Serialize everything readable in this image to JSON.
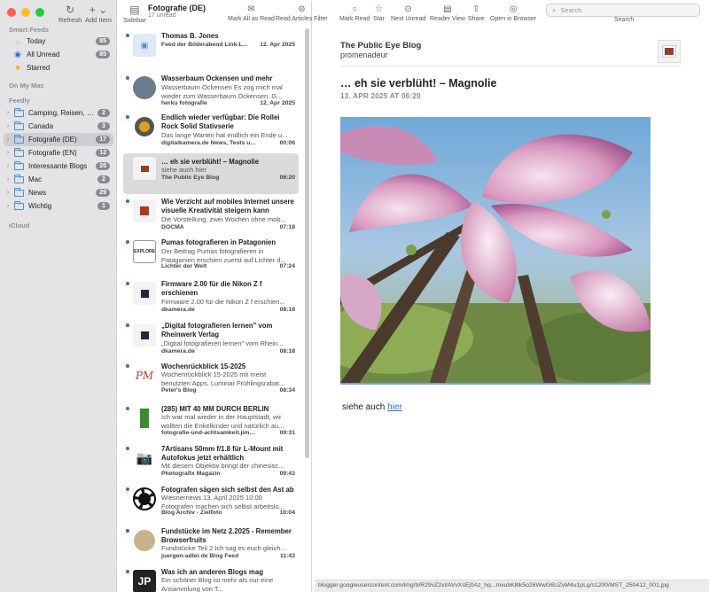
{
  "sidebar": {
    "refresh_label": "Refresh",
    "add_item_label": "Add Item",
    "smart_feeds_header": "Smart Feeds",
    "smart_feeds": [
      {
        "label": "Today",
        "count": "85"
      },
      {
        "label": "All Unread",
        "count": "85"
      },
      {
        "label": "Starred",
        "count": ""
      }
    ],
    "on_my_mac_header": "On My Mac",
    "feedly_header": "Feedly",
    "folders": [
      {
        "label": "Camping, Reisen, Ge...",
        "count": "2"
      },
      {
        "label": "Canada",
        "count": "3"
      },
      {
        "label": "Fotografie (DE)",
        "count": "17"
      },
      {
        "label": "Fotografie (EN)",
        "count": "12"
      },
      {
        "label": "Interessante Blogs",
        "count": "20"
      },
      {
        "label": "Mac",
        "count": "2"
      },
      {
        "label": "News",
        "count": "29"
      },
      {
        "label": "Wichtig",
        "count": "1"
      }
    ],
    "icloud_header": "iCloud"
  },
  "list": {
    "sidebar_btn_label": "Sidebar",
    "title": "Fotografie (DE)",
    "subtitle": "17 unread",
    "articles": [
      {
        "title": "Thomas B. Jones",
        "summary": "",
        "source": "Feed der Bilderabend Link-L...",
        "date": "12. Apr 2025"
      },
      {
        "title": "Wasserbaum Ockensen und mehr",
        "summary": "Wasserbaum Ockensen Es zog mich mal wieder zum Wasserbaum Ockensen. G...",
        "source": "herku fotografie",
        "date": "12. Apr 2025"
      },
      {
        "title": "Endlich wieder verfügbar: Die Rollei Rock Solid Stativserie",
        "summary": "Das lange Warten hat endlich ein Ende u...",
        "source": "digitalkamera.de News, Tests und...",
        "date": "00:06"
      },
      {
        "title": "… eh sie verblüht! – Magnolie",
        "summary": "siehe auch hier",
        "source": "The Public Eye Blog",
        "date": "06:20"
      },
      {
        "title": "Wie Verzicht auf mobiles Internet unsere visuelle Kreativität steigern kann",
        "summary": "Die Vorstellung, zwei Wochen ohne mob...",
        "source": "DOCMA",
        "date": "07:18"
      },
      {
        "title": "Pumas fotografieren in Patagonien",
        "summary": "Der Beitrag Pumas fotografieren in Patagonien erschien zuerst auf Lichter d...",
        "source": "Lichter der Welt",
        "date": "07:24"
      },
      {
        "title": "Firmware 2.00 für die Nikon Z f erschienen",
        "summary": "Firmware 2.00 für die Nikon Z f erschien...",
        "source": "dkamera.de",
        "date": "08:18"
      },
      {
        "title": "„Digital fotografieren lernen\" vom Rheinwerk Verlag",
        "summary": "„Digital fotografieren lernen\" vom Rhein...",
        "source": "dkamera.de",
        "date": "08:18"
      },
      {
        "title": "Wochenrückblick 15-2025",
        "summary": "Wochenrückblick 15-2025 mit meist benutzten Apps, Luminar Frühlingsrabat...",
        "source": "Peter's Blog",
        "date": "08:34"
      },
      {
        "title": "(285) MIT 40 MM DURCH BERLIN",
        "summary": "Ich war mal wieder in der Hauptstadt, wir wollten die Enkelkinder und natürlich au...",
        "source": "fotografie-und-achtsamkeit.jimdof...",
        "date": "09:31"
      },
      {
        "title": "7Artisans 50mm f/1.8 für L-Mount mit Autofokus jetzt erhältlich",
        "summary": "Mit diesem Objektiv bringt der chinesisc...",
        "source": "Photografix Magazin",
        "date": "09:43"
      },
      {
        "title": "Fotografen sägen sich selbst den Ast ab",
        "summary": "Wiesnernews 13. April 2025 10:00 Fotografen machen sich selbst arbeitslo...",
        "source": "Blog Archiv - Zielfoto",
        "date": "10:04"
      },
      {
        "title": "Fundstücke im Netz 2.2025 - Remember Browserfruits",
        "summary": "Fundstücke Teil 2 Ich sag es euch gleich...",
        "source": "juergen-adler.de Blog Feed",
        "date": "11:43"
      },
      {
        "title": "Was ich an anderen Blogs mag",
        "summary": "Ein schöner Blog ist mehr als nur eine Ansammlung von T...",
        "source": "",
        "date": ""
      }
    ]
  },
  "toolbar": {
    "mark_all_read": "Mark All as Read",
    "read_articles_filter": "Read Articles Filter",
    "mark_read": "Mark Read",
    "star": "Star",
    "next_unread": "Next Unread",
    "reader_view": "Reader View",
    "share": "Share",
    "open_in_browser": "Open in Browser",
    "search_placeholder": "Search",
    "search_label": "Search"
  },
  "content": {
    "blog_name": "The Public Eye Blog",
    "author": "promenadeur",
    "title": "… eh sie verblüht! – Magnolie",
    "date": "13. APR 2025 AT 06:20",
    "body_prefix": "siehe auch",
    "body_link": "hier",
    "status_url": "blogger.googleusercontent.com/img/b/R29vZ2xl/AVvXsEj0Az_hq...mxubK8lk5o26WwG6UZvM4u1pLg/s1200/MST_250412_001.jpg"
  },
  "colors": {
    "accent": "#2c6fd6",
    "selection": "#dadadd",
    "sidebar_bg": "#e4e4e6",
    "badge": "#8a8a8e"
  }
}
